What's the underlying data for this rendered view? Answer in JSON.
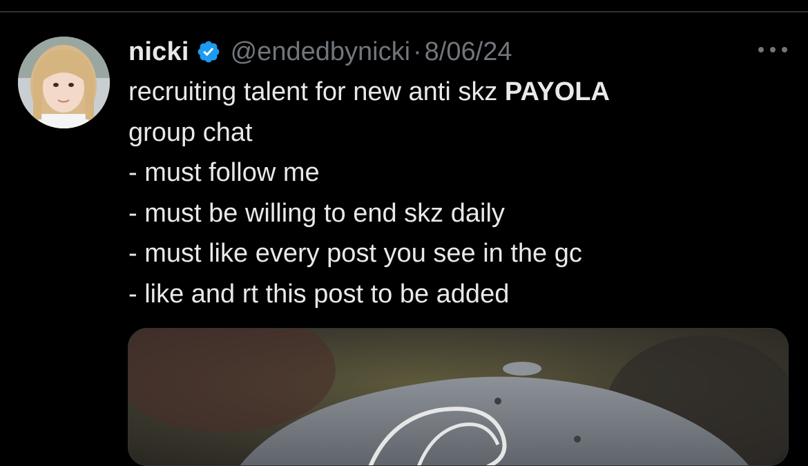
{
  "tweet": {
    "display_name": "nicki",
    "handle": "@endedbynicki",
    "separator": "·",
    "date": "8/06/24",
    "text": {
      "line1_pre": "recruiting talent for new anti skz ",
      "line1_bold": "PAYOLA",
      "line2": "group chat",
      "line3": "- must follow me",
      "line4": "- must be willing to end skz daily",
      "line5": "- must like every post you see in the gc",
      "line6": "- like and rt this post to be added"
    }
  },
  "icons": {
    "verified": "verified-badge-icon",
    "more": "more-options-icon"
  },
  "colors": {
    "background": "#000000",
    "text_primary": "#e7e9ea",
    "text_secondary": "#71767b",
    "verified_blue": "#1d9bf0",
    "divider": "#2f3336"
  }
}
